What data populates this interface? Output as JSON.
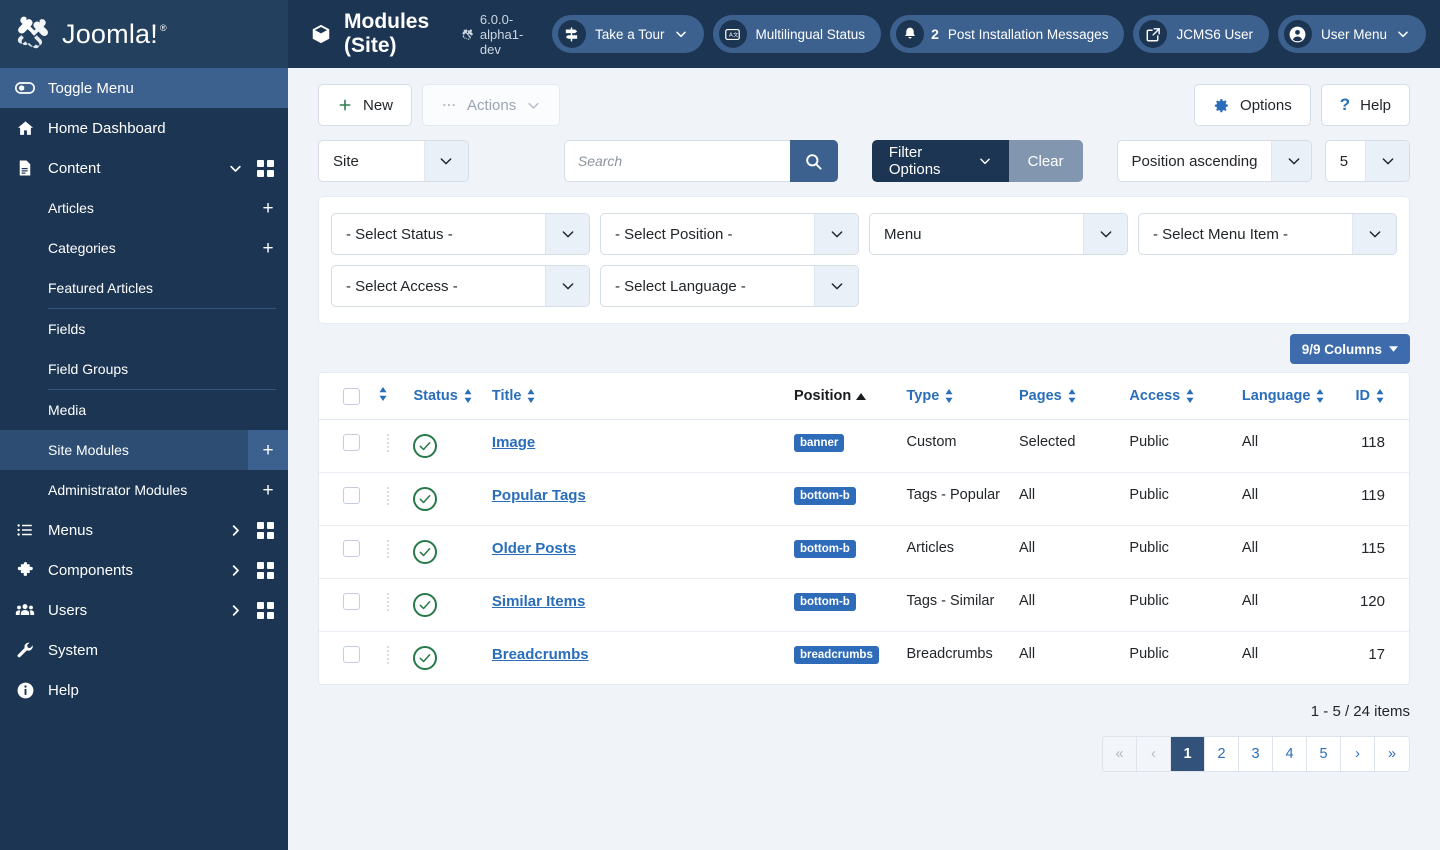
{
  "brand": {
    "name": "Joomla!",
    "registered": "®"
  },
  "sidebar": {
    "toggle": {
      "label": "Toggle Menu",
      "icon": "toggle-icon"
    },
    "items": [
      {
        "label": "Home Dashboard",
        "icon": "home-icon",
        "has_chevron": false,
        "has_grid": false
      },
      {
        "label": "Content",
        "icon": "document-icon",
        "has_chevron": true,
        "has_grid": true
      },
      {
        "label": "Menus",
        "icon": "list-icon",
        "has_chevron": true,
        "has_grid": true
      },
      {
        "label": "Components",
        "icon": "puzzle-icon",
        "has_chevron": true,
        "has_grid": true
      },
      {
        "label": "Users",
        "icon": "users-icon",
        "has_chevron": true,
        "has_grid": true
      },
      {
        "label": "System",
        "icon": "wrench-icon",
        "has_chevron": false,
        "has_grid": false
      },
      {
        "label": "Help",
        "icon": "info-icon",
        "has_chevron": false,
        "has_grid": false
      }
    ],
    "content_children": [
      {
        "label": "Articles",
        "plus": "+",
        "sep_after": false
      },
      {
        "label": "Categories",
        "plus": "+",
        "sep_after": false
      },
      {
        "label": "Featured Articles",
        "plus": "",
        "sep_after": true
      },
      {
        "label": "Fields",
        "plus": "",
        "sep_after": false
      },
      {
        "label": "Field Groups",
        "plus": "",
        "sep_after": true
      },
      {
        "label": "Media",
        "plus": "",
        "sep_after": false
      },
      {
        "label": "Site Modules",
        "plus": "+",
        "sep_after": false,
        "active": true
      },
      {
        "label": "Administrator Modules",
        "plus": "+",
        "sep_after": false
      }
    ]
  },
  "header": {
    "title": "Modules (Site)",
    "title_icon": "cube-icon",
    "version": "6.0.0-alpha1-dev",
    "pills": [
      {
        "label": "Take a Tour",
        "icon": "signpost-icon",
        "count": "",
        "chevron": true
      },
      {
        "label": "Multilingual Status",
        "icon": "translate-icon",
        "count": "",
        "chevron": false
      },
      {
        "label": "Post Installation Messages",
        "icon": "bell-icon",
        "count": "2",
        "chevron": false
      },
      {
        "label": "JCMS6 User",
        "icon": "external-link-icon",
        "count": "",
        "chevron": false
      },
      {
        "label": "User Menu",
        "icon": "user-icon",
        "count": "",
        "chevron": true
      }
    ]
  },
  "toolbar": {
    "new_label": "New",
    "actions_label": "Actions",
    "options_label": "Options",
    "help_label": "Help"
  },
  "filterbar": {
    "client_value": "Site",
    "search_placeholder": "Search",
    "search_value": "",
    "filter_options_label": "Filter Options",
    "clear_label": "Clear",
    "sort_value": "Position ascending",
    "limit_value": "5"
  },
  "filters": [
    {
      "value": "- Select Status -"
    },
    {
      "value": "- Select Position -"
    },
    {
      "value": "Menu"
    },
    {
      "value": "- Select Menu Item -"
    },
    {
      "value": "- Select Access -"
    },
    {
      "value": "- Select Language -"
    }
  ],
  "columns_button": "9/9 Columns",
  "table": {
    "headers": [
      {
        "label": "",
        "key": "check"
      },
      {
        "label": "",
        "key": "ordering",
        "sortable": true
      },
      {
        "label": "Status",
        "key": "status",
        "sortable": true
      },
      {
        "label": "Title",
        "key": "title",
        "sortable": true
      },
      {
        "label": "Position",
        "key": "position",
        "sortable": true,
        "active": true,
        "dir": "asc"
      },
      {
        "label": "Type",
        "key": "type",
        "sortable": true
      },
      {
        "label": "Pages",
        "key": "pages",
        "sortable": true
      },
      {
        "label": "Access",
        "key": "access",
        "sortable": true
      },
      {
        "label": "Language",
        "key": "language",
        "sortable": true
      },
      {
        "label": "ID",
        "key": "id",
        "sortable": true
      }
    ],
    "rows": [
      {
        "status": "published",
        "title": "Image",
        "position": "banner",
        "type": "Custom",
        "pages": "Selected",
        "access": "Public",
        "language": "All",
        "id": "118"
      },
      {
        "status": "published",
        "title": "Popular Tags",
        "position": "bottom-b",
        "type": "Tags - Popular",
        "pages": "All",
        "access": "Public",
        "language": "All",
        "id": "119"
      },
      {
        "status": "published",
        "title": "Older Posts",
        "position": "bottom-b",
        "type": "Articles",
        "pages": "All",
        "access": "Public",
        "language": "All",
        "id": "115"
      },
      {
        "status": "published",
        "title": "Similar Items",
        "position": "bottom-b",
        "type": "Tags - Similar",
        "pages": "All",
        "access": "Public",
        "language": "All",
        "id": "120"
      },
      {
        "status": "published",
        "title": "Breadcrumbs",
        "position": "breadcrumbs",
        "type": "Breadcrumbs",
        "pages": "All",
        "access": "Public",
        "language": "All",
        "id": "17"
      }
    ]
  },
  "footer": {
    "counts": "1 - 5 / 24 items",
    "pages": [
      {
        "label": "«",
        "state": "disabled"
      },
      {
        "label": "‹",
        "state": "disabled"
      },
      {
        "label": "1",
        "state": "active"
      },
      {
        "label": "2",
        "state": "normal"
      },
      {
        "label": "3",
        "state": "normal"
      },
      {
        "label": "4",
        "state": "normal"
      },
      {
        "label": "5",
        "state": "normal"
      },
      {
        "label": "›",
        "state": "normal"
      },
      {
        "label": "»",
        "state": "normal"
      }
    ]
  },
  "colors": {
    "sidebar_bg": "#1c3552",
    "sidebar_active": "#2d4d72",
    "accent_blue": "#2a6ebb",
    "badge_blue": "#2e6bb8",
    "status_green": "#28794a",
    "clear_gray": "#8296b0"
  }
}
